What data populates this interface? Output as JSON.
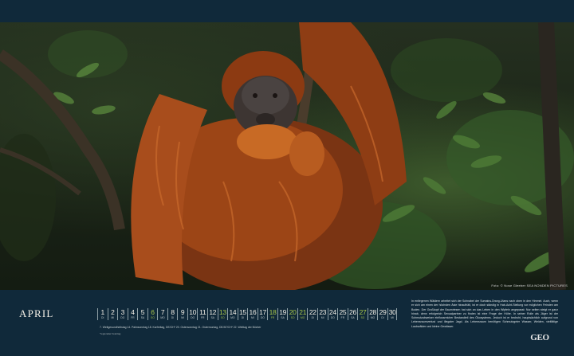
{
  "photo": {
    "subject": "orangutan-photo",
    "credit": "Foto: © Nose Gleeber SEA NONDEN PICTURES"
  },
  "calendar": {
    "month": "APRIL",
    "days": [
      {
        "num": "1",
        "wd": "DI"
      },
      {
        "num": "2",
        "wd": "MI"
      },
      {
        "num": "3",
        "wd": "DO"
      },
      {
        "num": "4",
        "wd": "FR"
      },
      {
        "num": "5",
        "wd": "SA"
      },
      {
        "num": "6",
        "wd": "SO",
        "sunday": true
      },
      {
        "num": "7",
        "wd": "MO"
      },
      {
        "num": "8",
        "wd": "DI"
      },
      {
        "num": "9",
        "wd": "MI"
      },
      {
        "num": "10",
        "wd": "DO"
      },
      {
        "num": "11",
        "wd": "FR"
      },
      {
        "num": "12",
        "wd": "SA"
      },
      {
        "num": "13",
        "wd": "SO",
        "sunday": true
      },
      {
        "num": "14",
        "wd": "MO"
      },
      {
        "num": "15",
        "wd": "DI"
      },
      {
        "num": "16",
        "wd": "MI"
      },
      {
        "num": "17",
        "wd": "DO"
      },
      {
        "num": "18",
        "wd": "FR",
        "sunday": true
      },
      {
        "num": "19",
        "wd": "SA"
      },
      {
        "num": "20",
        "wd": "SO",
        "sunday": true
      },
      {
        "num": "21",
        "wd": "MO",
        "sunday": true
      },
      {
        "num": "22",
        "wd": "DI"
      },
      {
        "num": "23",
        "wd": "MI"
      },
      {
        "num": "24",
        "wd": "DO"
      },
      {
        "num": "25",
        "wd": "FR"
      },
      {
        "num": "26",
        "wd": "SA"
      },
      {
        "num": "27",
        "wd": "SO",
        "sunday": true
      },
      {
        "num": "28",
        "wd": "MO"
      },
      {
        "num": "29",
        "wd": "DI"
      },
      {
        "num": "30",
        "wd": "MI"
      }
    ],
    "holidays": "7. Weltgesundheitstag   14. Palmsonntag   18. Karfreitag, DE/CH*   20. Ostersonntag   21. Ostermontag, DE/AT/CH*   22. Welttag der Bücher",
    "footnote": "*regionaler Feiertag"
  },
  "description": "In entlegenen Wäldern arbeitet sich der Schnabel der Sumatra-Orang-Utans nach oben in den Himmel. Auch, wenn er sich am einen der höchsten Äste hinaufhält, ist er doch ständig in Hab-Acht-Stellung vor möglichen Feinden am Boden. Der Großkopf der Baumriesen hat sich an das Leben in den Wipfeln angepasst: Nur selten steigt er ganz hinab, denn erfolgreich Sexualpartner zu finden ist eine Frage der Höhe. In seiner Rolle als Jäger ist der Schmutzabweiser einflussreicher Bestandteil des Ökosystems. Jedoch ist er bedroht, hauptsächlich aufgrund von Lebensraumverlust und illegaler Jagd. Als Lebensraum benötigen Schmutzgeier Wasser, Weiden, vielfältige Laubwälder und kleine Gewässer.",
  "logo": "GEO"
}
